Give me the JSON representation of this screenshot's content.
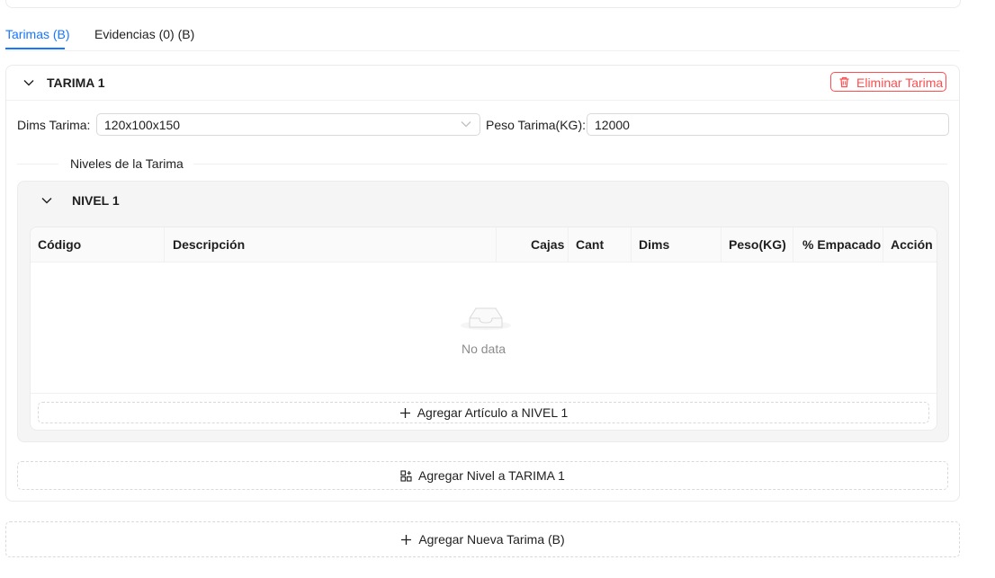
{
  "tabs": [
    {
      "label": "Tarimas (B)",
      "active": true
    },
    {
      "label": "Evidencias (0) (B)",
      "active": false
    }
  ],
  "tarima": {
    "title": "TARIMA 1",
    "delete_label": "Eliminar Tarima",
    "dims_label": "Dims Tarima",
    "dims_value": "120x100x150",
    "peso_label": "Peso Tarima(KG)",
    "peso_value": "12000",
    "levels_divider": "Niveles de la Tarima",
    "add_level_label": "Agregar Nivel a TARIMA 1"
  },
  "nivel": {
    "title": "NIVEL 1",
    "columns": [
      "Código",
      "Descripción",
      "Cajas",
      "Cant",
      "Dims",
      "Peso(KG)",
      "% Empacado",
      "Acción"
    ],
    "empty_text": "No data",
    "add_item_label": "Agregar Artículo a NIVEL 1"
  },
  "add_tarima_label": "Agregar Nueva Tarima (B)",
  "colors": {
    "accent": "#1677ff",
    "danger": "#ff4d4f",
    "border": "#d9d9d9",
    "level_bg": "#f5f5f5"
  }
}
